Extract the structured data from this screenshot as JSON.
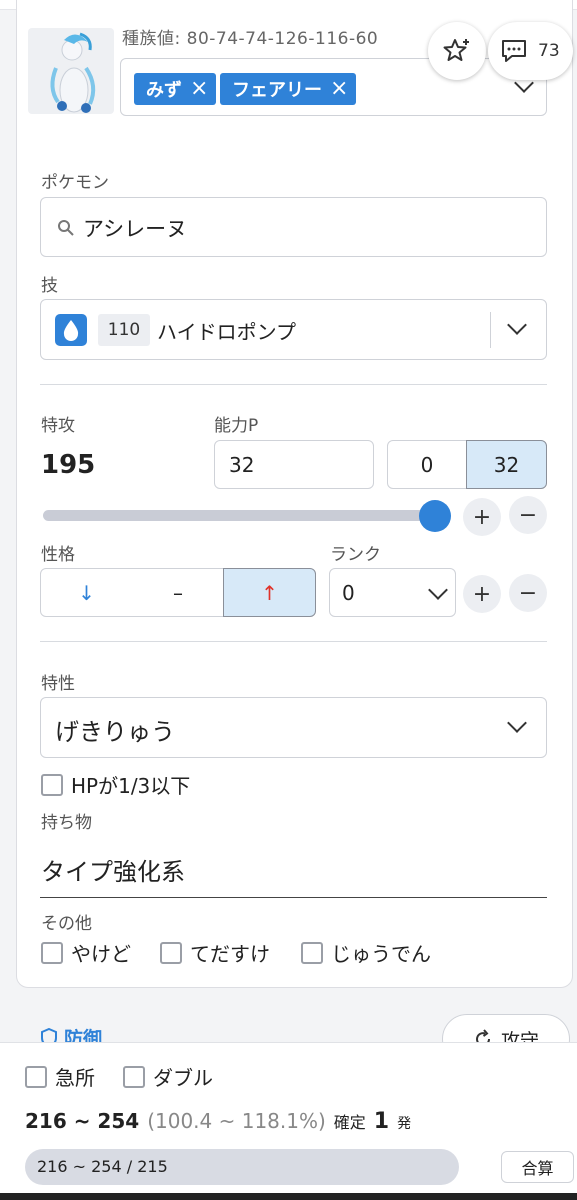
{
  "header": {
    "stats_label": "種族値: 80-74-74-126-116-60",
    "types": [
      {
        "label": "みず"
      },
      {
        "label": "フェアリー"
      }
    ],
    "comment_count": "73"
  },
  "pokemon": {
    "label": "ポケモン",
    "value": "アシレーヌ"
  },
  "move": {
    "label": "技",
    "power": "110",
    "name": "ハイドロポンプ"
  },
  "stat": {
    "label": "特攻",
    "value": "195",
    "ev_label": "能力P",
    "ev_value": "32",
    "ev_presets": [
      "0",
      "32"
    ],
    "slider_fraction": 1.0
  },
  "nature": {
    "label": "性格",
    "options": [
      "↓",
      "–",
      "↑"
    ],
    "selected_index": 2
  },
  "rank": {
    "label": "ランク",
    "value": "0"
  },
  "ability": {
    "label": "特性",
    "value": "げきりゅう",
    "checkbox_label": "HPが1/3以下"
  },
  "item": {
    "label": "持ち物",
    "value": "タイプ強化系"
  },
  "other": {
    "label": "その他",
    "options": [
      "やけど",
      "てだすけ",
      "じゅうでん"
    ]
  },
  "next_section": {
    "defense_label": "防御",
    "swap_label": "攻守"
  },
  "result": {
    "crit_label": "急所",
    "double_label": "ダブル",
    "damage_range": "216 ~ 254",
    "percent_range": "(100.4 ~ 118.1%)",
    "verdict_prefix": "確定",
    "verdict_count": "1",
    "verdict_suffix": "発",
    "bar_text": "216 ~ 254 / 215",
    "total_button": "合算"
  },
  "colors": {
    "accent": "#2f82d8",
    "active_seg": "#d7e9f8",
    "up_arrow": "#e0322a",
    "down_arrow": "#2f82d8"
  }
}
